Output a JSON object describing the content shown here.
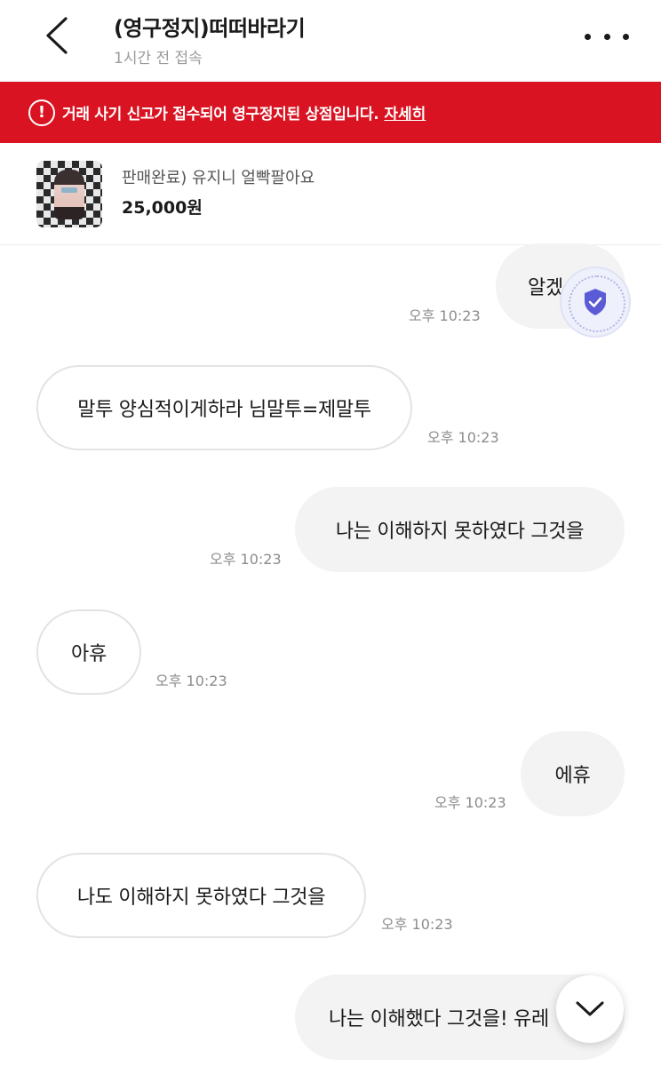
{
  "header": {
    "title": "(영구정지)떠떠바라기",
    "status": "1시간 전 접속"
  },
  "banner": {
    "message": "거래 사기 신고가 접수되어 영구정지된 상점입니다.",
    "link_label": "자세히",
    "color": "#d91321"
  },
  "product": {
    "title": "판매완료) 유지니 얼빡팔아요",
    "price": "25,000원"
  },
  "messages": [
    {
      "side": "right",
      "text": "알겠",
      "time": "오후 10:23"
    },
    {
      "side": "left",
      "text": "말투 양심적이게하라 님말투=제말투",
      "time": "오후 10:23"
    },
    {
      "side": "right",
      "text": "나는 이해하지 못하였다 그것을",
      "time": "오후 10:23"
    },
    {
      "side": "left",
      "text": "아휴",
      "time": "오후 10:23"
    },
    {
      "side": "right",
      "text": "에휴",
      "time": "오후 10:23"
    },
    {
      "side": "left",
      "text": "나도 이해하지 못하였다 그것을",
      "time": "오후 10:23"
    },
    {
      "side": "right",
      "text": "나는 이해했다 그것을! 유레",
      "time": ""
    }
  ],
  "icons": {
    "back": "chevron-left-icon",
    "more": "more-horizontal-icon",
    "warning": "alert-circle-icon",
    "shield": "shield-check-icon",
    "scroll": "chevron-down-icon"
  },
  "colors": {
    "accent_purple": "#5b5bd6",
    "bubble_right": "#f3f3f4"
  }
}
